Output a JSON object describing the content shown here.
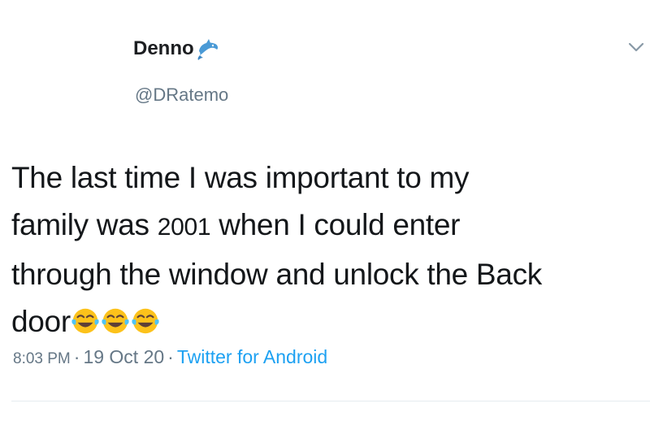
{
  "tweet": {
    "display_name": "Denno",
    "handle": "@DRatemo",
    "text_lines": [
      "The last time I was important to my",
      "family was",
      "2001",
      "when I could enter",
      "through the window and unlock the Back",
      "door"
    ],
    "emoji_count": 3,
    "emoji_name": "face-with-tears-of-joy-icon",
    "badge_icon": "dolphin-icon",
    "meta": {
      "time": "8:03 PM",
      "date": "19 Oct 20",
      "separator": "·",
      "source": "Twitter for Android"
    }
  },
  "colors": {
    "text": "#14171a",
    "secondary": "#657786",
    "link": "#1da1f2",
    "badge": "#4a9ad6",
    "emoji_face": "#fcc21b"
  }
}
